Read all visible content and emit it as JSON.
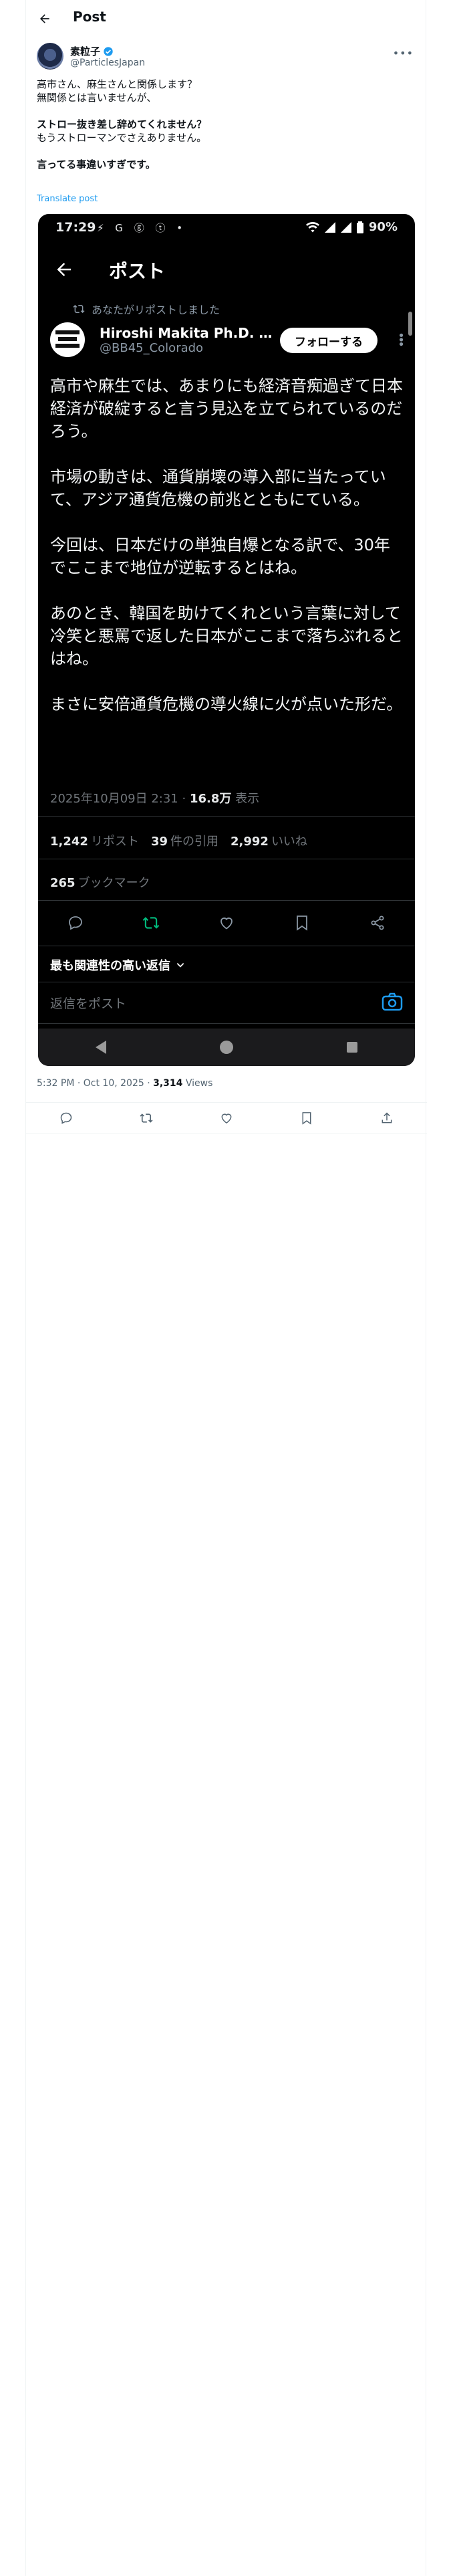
{
  "header": {
    "title": "Post"
  },
  "author": {
    "name": "素粒子",
    "handle": "@ParticlesJapan"
  },
  "post": {
    "line1": "高市さん、麻生さんと関係します？",
    "line2": "無関係とは言いませんが、",
    "line3": "ストロー抜き差し辞めてくれません？",
    "line4": "もうストローマンでさえありません。",
    "line5": "言ってる事違いすぎです。",
    "translate_label": "Translate post",
    "timestamp": "5:32 PM · Oct 10, 2025 · ",
    "views_count": "3,314",
    "views_label": " Views"
  },
  "embedded": {
    "status": {
      "time": "17:29",
      "left_icons": "⚡ G ⓖ ⓣ •",
      "battery": "90%"
    },
    "header_title": "ポスト",
    "repost_note": "あなたがリポストしました",
    "user": {
      "name": "Hiroshi Makita Ph.D. 難...",
      "handle": "@BB45_Colorado",
      "follow_label": "フォローする"
    },
    "paragraphs": [
      "高市や麻生では、あまりにも経済音痴過ぎて日本経済が破綻すると言う見込を立てられているのだろう。",
      "市場の動きは、通貨崩壊の導入部に当たっていて、アジア通貨危機の前兆とともにている。",
      "今回は、日本だけの単独自爆となる訳で、30年でここまで地位が逆転するとはね。",
      "あのとき、韓国を助けてくれという言葉に対して冷笑と悪罵で返した日本がここまで落ちぶれるとはね。",
      "まさに安倍通貨危機の導火線に火が点いた形だ。"
    ],
    "meta_date": "2025年10月09日 2:31 · ",
    "meta_views": "16.8万",
    "meta_views_label": " 表示",
    "stats": {
      "reposts": "1,242",
      "reposts_label": "リポスト",
      "quotes": "39",
      "quotes_label": "件の引用",
      "likes": "2,992",
      "likes_label": "いいね",
      "bookmarks": "265",
      "bookmarks_label": "ブックマーク"
    },
    "relevant_label": "最も関連性の高い返信",
    "reply_placeholder": "返信をポスト"
  }
}
